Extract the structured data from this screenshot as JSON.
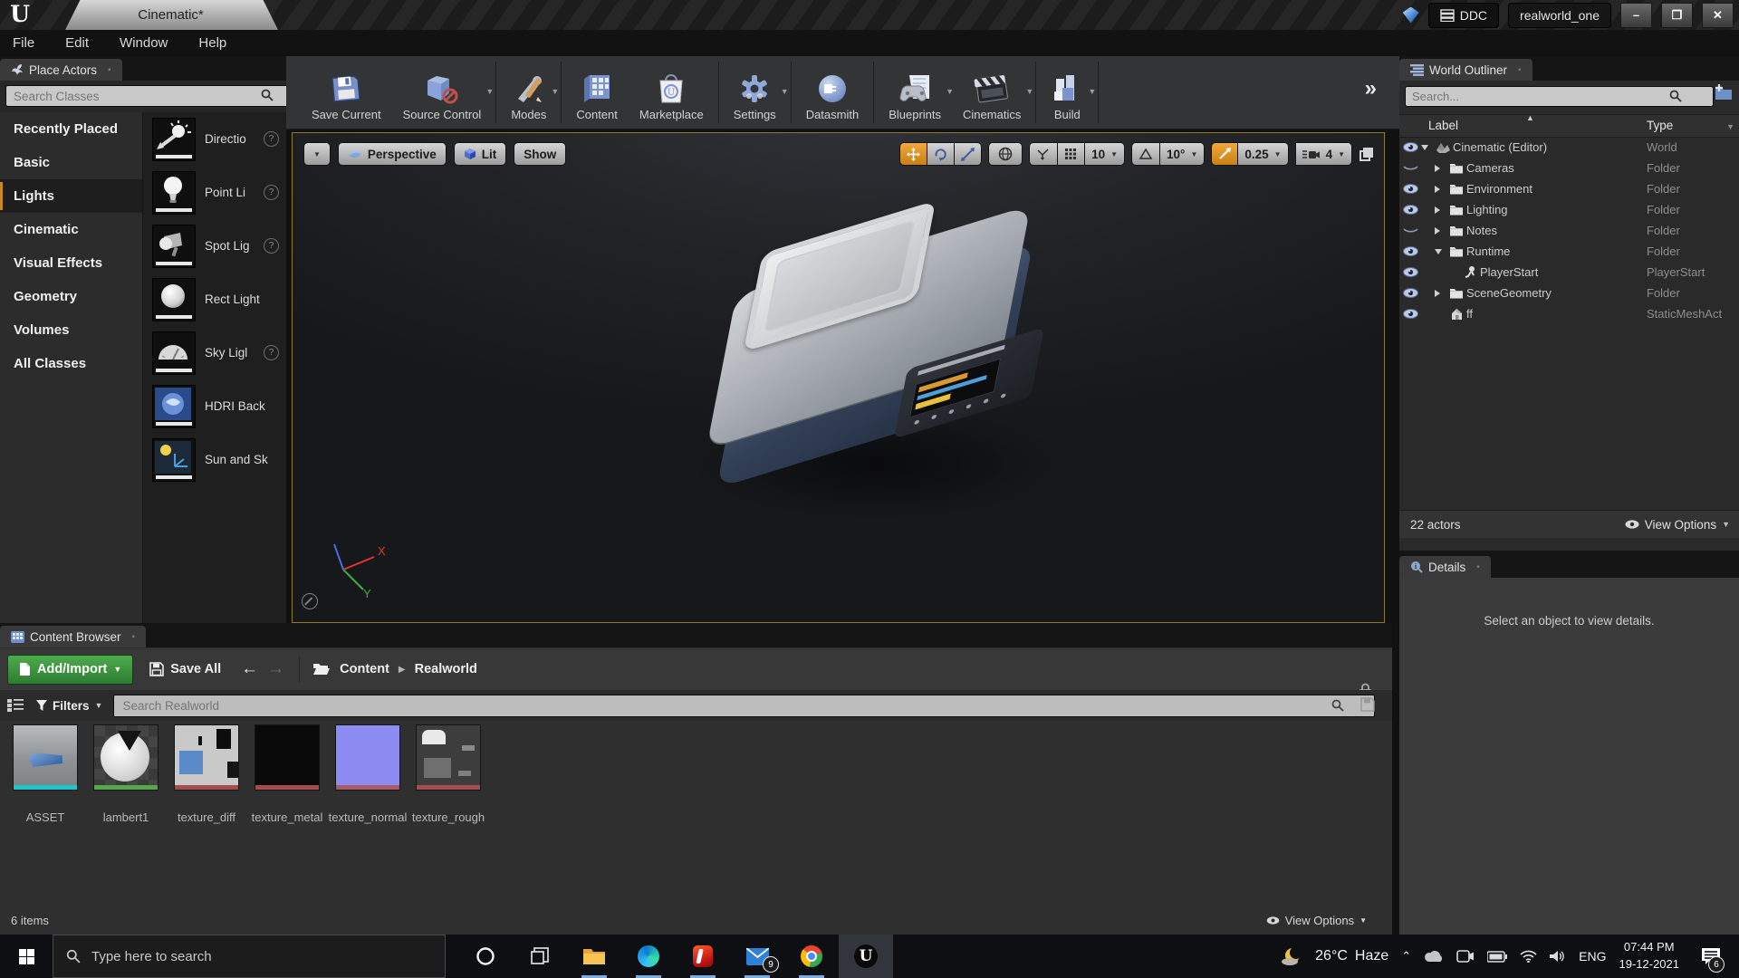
{
  "titlebar": {
    "tab": "Cinematic*",
    "ddc": "DDC",
    "project": "realworld_one",
    "minimize": "–",
    "restore": "❐",
    "close": "✕"
  },
  "menubar": {
    "items": [
      {
        "label": "File"
      },
      {
        "label": "Edit"
      },
      {
        "label": "Window"
      },
      {
        "label": "Help"
      }
    ]
  },
  "place_actors": {
    "title": "Place Actors",
    "search_placeholder": "Search Classes",
    "categories": [
      {
        "label": "Recently Placed",
        "selected": false
      },
      {
        "label": "Basic",
        "selected": false
      },
      {
        "label": "Lights",
        "selected": true
      },
      {
        "label": "Cinematic",
        "selected": false
      },
      {
        "label": "Visual Effects",
        "selected": false
      },
      {
        "label": "Geometry",
        "selected": false
      },
      {
        "label": "Volumes",
        "selected": false
      },
      {
        "label": "All Classes",
        "selected": false
      }
    ],
    "items": [
      {
        "label": "Directio",
        "icon": "pa-dir",
        "help": true
      },
      {
        "label": "Point Li",
        "icon": "pa-point",
        "help": true
      },
      {
        "label": "Spot Lig",
        "icon": "pa-spot",
        "help": true
      },
      {
        "label": "Rect Light",
        "icon": "pa-rect",
        "help": false
      },
      {
        "label": "Sky Ligl",
        "icon": "pa-sky",
        "help": true
      },
      {
        "label": "HDRI Back",
        "icon": "pa-hdri",
        "help": false
      },
      {
        "label": "Sun and Sk",
        "icon": "pa-sunsky",
        "help": false
      }
    ]
  },
  "toolbar": {
    "buttons": [
      {
        "label": "Save Current",
        "icon": "tb-save",
        "dropdown": false,
        "divider": false
      },
      {
        "label": "Source Control",
        "icon": "tb-source",
        "dropdown": true,
        "divider": true
      },
      {
        "label": "Modes",
        "icon": "tb-modes",
        "dropdown": true,
        "divider": true
      },
      {
        "label": "Content",
        "icon": "tb-content",
        "dropdown": false,
        "divider": false
      },
      {
        "label": "Marketplace",
        "icon": "tb-market",
        "dropdown": false,
        "divider": true
      },
      {
        "label": "Settings",
        "icon": "tb-settings",
        "dropdown": true,
        "divider": true
      },
      {
        "label": "Datasmith",
        "icon": "tb-datasmith",
        "dropdown": false,
        "divider": true
      },
      {
        "label": "Blueprints",
        "icon": "tb-blueprints",
        "dropdown": true,
        "divider": false
      },
      {
        "label": "Cinematics",
        "icon": "tb-cinematics",
        "dropdown": true,
        "divider": true
      },
      {
        "label": "Build",
        "icon": "tb-build",
        "dropdown": true,
        "divider": true
      }
    ],
    "overflow_chevron": "»"
  },
  "viewport": {
    "perspective_label": "Perspective",
    "lit_label": "Lit",
    "show_label": "Show",
    "grid_snap_value": "10",
    "angle_snap_value": "10°",
    "scale_snap_value": "0.25",
    "camera_speed_value": "4",
    "axis_x": "X",
    "axis_y": "Y"
  },
  "outliner": {
    "title": "World Outliner",
    "search_placeholder": "Search...",
    "col_label": "Label",
    "col_type": "Type",
    "rows": [
      {
        "label": "Cinematic (Editor)",
        "type": "World",
        "indent": 0,
        "expander": "open",
        "icon": "ol-world",
        "eye": "eye-visible"
      },
      {
        "label": "Cameras",
        "type": "Folder",
        "indent": 1,
        "expander": "closed",
        "icon": "ol-folder",
        "eye": "eye-hidden"
      },
      {
        "label": "Environment",
        "type": "Folder",
        "indent": 1,
        "expander": "closed",
        "icon": "ol-folder",
        "eye": "eye-visible"
      },
      {
        "label": "Lighting",
        "type": "Folder",
        "indent": 1,
        "expander": "closed",
        "icon": "ol-folder",
        "eye": "eye-visible"
      },
      {
        "label": "Notes",
        "type": "Folder",
        "indent": 1,
        "expander": "closed",
        "icon": "ol-folder",
        "eye": "eye-hidden"
      },
      {
        "label": "Runtime",
        "type": "Folder",
        "indent": 1,
        "expander": "open",
        "icon": "ol-folder",
        "eye": "eye-visible"
      },
      {
        "label": "PlayerStart",
        "type": "PlayerStart",
        "indent": 2,
        "expander": "none",
        "icon": "ol-player",
        "eye": "eye-visible"
      },
      {
        "label": "SceneGeometry",
        "type": "Folder",
        "indent": 1,
        "expander": "closed",
        "icon": "ol-folder",
        "eye": "eye-visible"
      },
      {
        "label": "ff",
        "type": "StaticMeshAct",
        "indent": 1,
        "expander": "none",
        "icon": "ol-mesh",
        "eye": "eye-visible"
      }
    ],
    "footer_count": "22 actors",
    "view_options_label": "View Options"
  },
  "details": {
    "title": "Details",
    "empty_text": "Select an object to view details."
  },
  "content_browser": {
    "title": "Content Browser",
    "add_import_label": "Add/Import",
    "save_all_label": "Save All",
    "breadcrumb_root": "Content",
    "breadcrumb_current": "Realworld",
    "filters_label": "Filters",
    "search_placeholder": "Search Realworld",
    "assets": [
      {
        "name": "ASSET",
        "kind": "asset",
        "stripe": "#1fc5c8"
      },
      {
        "name": "lambert1",
        "kind": "sphere",
        "stripe": "#57a64a"
      },
      {
        "name": "texture_diff",
        "kind": "diff",
        "stripe": "#a34d4d"
      },
      {
        "name": "texture_metal",
        "kind": "metal",
        "stripe": "#a34d4d"
      },
      {
        "name": "texture_normal",
        "kind": "normal",
        "stripe": "#a85c6a"
      },
      {
        "name": "texture_rough",
        "kind": "rough",
        "stripe": "#a34d4d"
      }
    ],
    "items_count": "6 items",
    "view_options_label": "View Options"
  },
  "taskbar": {
    "search_placeholder": "Type here to search",
    "weather_temp": "26°C",
    "weather_desc": "Haze",
    "language": "ENG",
    "time": "07:44 PM",
    "date": "19-12-2021",
    "mail_badge": "9",
    "notification_badge": "6"
  },
  "colors": {
    "accent_orange": "#c8881e",
    "selection_yellow": "#8e7a28",
    "add_import_green": "#3f9a43",
    "taskbar_underline": "#76aee0"
  }
}
